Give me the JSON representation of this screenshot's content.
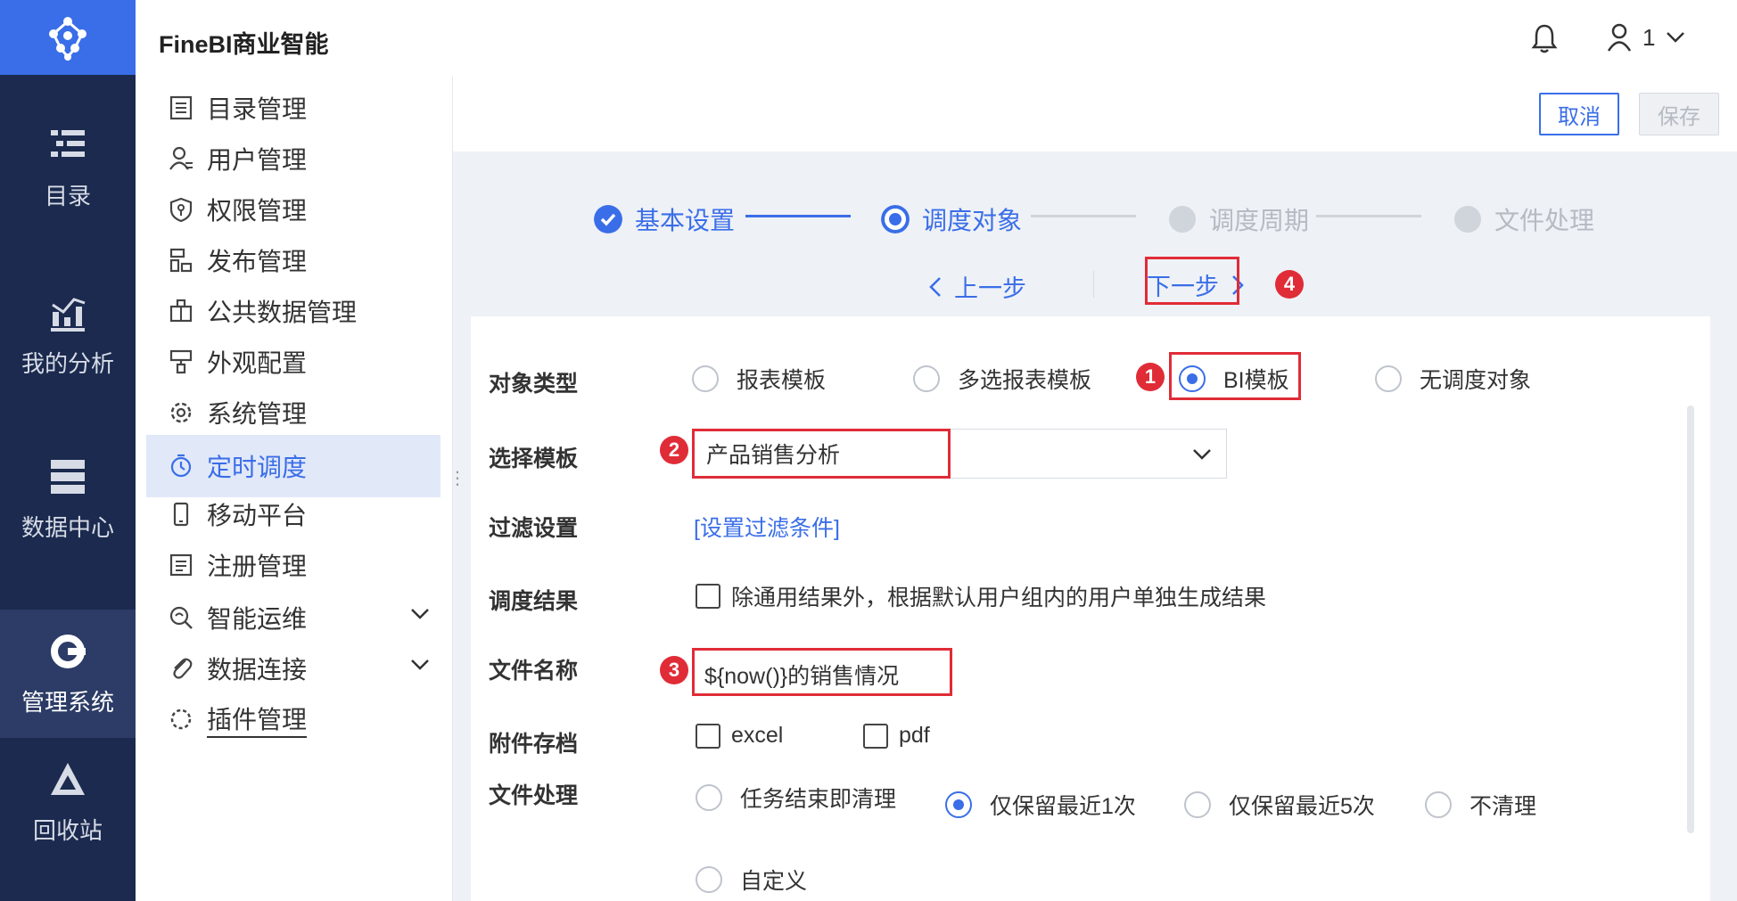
{
  "app": {
    "title": "FineBI商业智能",
    "user": "1"
  },
  "rail": {
    "items": [
      {
        "label": "目录",
        "icon": "catalog-icon"
      },
      {
        "label": "我的分析",
        "icon": "analysis-icon"
      },
      {
        "label": "数据中心",
        "icon": "database-icon"
      },
      {
        "label": "管理系统",
        "icon": "management-icon"
      },
      {
        "label": "回收站",
        "icon": "recycle-icon"
      }
    ]
  },
  "menu": {
    "items": [
      {
        "label": "目录管理",
        "icon": "directory-icon"
      },
      {
        "label": "用户管理",
        "icon": "user-icon"
      },
      {
        "label": "权限管理",
        "icon": "permission-icon"
      },
      {
        "label": "发布管理",
        "icon": "publish-icon"
      },
      {
        "label": "公共数据管理",
        "icon": "public-data-icon"
      },
      {
        "label": "外观配置",
        "icon": "appearance-icon"
      },
      {
        "label": "系统管理",
        "icon": "gear-icon"
      },
      {
        "label": "定时调度",
        "icon": "timer-icon"
      },
      {
        "label": "移动平台",
        "icon": "mobile-icon"
      },
      {
        "label": "注册管理",
        "icon": "register-icon"
      },
      {
        "label": "智能运维",
        "icon": "ops-icon"
      },
      {
        "label": "数据连接",
        "icon": "link-icon"
      },
      {
        "label": "插件管理",
        "icon": "plugin-icon"
      }
    ]
  },
  "actions": {
    "cancel": "取消",
    "save": "保存"
  },
  "steps": [
    "基本设置",
    "调度对象",
    "调度周期",
    "文件处理"
  ],
  "nav": {
    "prev": "上一步",
    "next": "下一步"
  },
  "form": {
    "object_type": {
      "label": "对象类型",
      "options": [
        "报表模板",
        "多选报表模板",
        "BI模板",
        "无调度对象"
      ],
      "selected": "BI模板"
    },
    "template": {
      "label": "选择模板",
      "value": "产品销售分析"
    },
    "filter": {
      "label": "过滤设置",
      "link": "[设置过滤条件]"
    },
    "result": {
      "label": "调度结果",
      "checkbox": "除通用结果外，根据默认用户组内的用户单独生成结果"
    },
    "filename": {
      "label": "文件名称",
      "value": "${now()}的销售情况"
    },
    "attachment": {
      "label": "附件存档",
      "options": [
        "excel",
        "pdf"
      ]
    },
    "file_handling": {
      "label": "文件处理",
      "options": [
        "任务结束即清理",
        "仅保留最近1次",
        "仅保留最近5次",
        "不清理",
        "自定义"
      ],
      "selected": "仅保留最近1次"
    }
  },
  "annotations": [
    "1",
    "2",
    "3",
    "4"
  ],
  "colors": {
    "accent": "#3a6ee8",
    "rail": "#1b2a4e",
    "annotation": "#e02c37"
  }
}
